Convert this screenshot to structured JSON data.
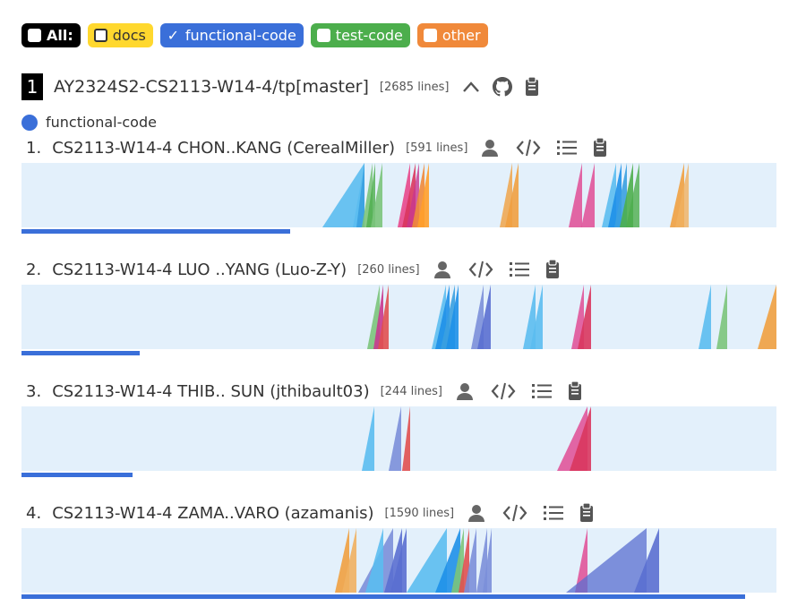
{
  "filters": {
    "all": "All:",
    "docs": "docs",
    "functional": "functional-code",
    "test": "test-code",
    "other": "other",
    "functional_check": "✓"
  },
  "repo": {
    "rank": "1",
    "name": "AY2324S2-CS2113-W14-4/tp[master]",
    "lines": "[2685 lines]"
  },
  "legend": {
    "label": "functional-code"
  },
  "colors": {
    "ramp_bg": "#e3f0fb",
    "functional": "#3a6fd9",
    "docs": "#ffd82e",
    "test": "#4cae4c",
    "other": "#f0893a"
  },
  "authors": [
    {
      "idx": "1.",
      "name": "CS2113-W14-4 CHON..KANG (CerealMiller)",
      "lines": "[591 lines]",
      "bar_fraction": 0.356,
      "spikes": [
        [
          336,
          383,
          "#5bbdf0",
          0.9
        ],
        [
          370,
          383,
          "#5bbdf0",
          0.9
        ],
        [
          374,
          383,
          "#3aa0e0",
          0.9
        ],
        [
          380,
          392,
          "#7bc47b",
          0.9
        ],
        [
          385,
          395,
          "#4cae4c",
          0.8
        ],
        [
          390,
          403,
          "#7bc47b",
          0.9
        ],
        [
          420,
          434,
          "#e8478b",
          0.9
        ],
        [
          425,
          440,
          "#d9365e",
          0.9
        ],
        [
          430,
          444,
          "#c8378f",
          0.8
        ],
        [
          436,
          450,
          "#f0893a",
          0.9
        ],
        [
          442,
          455,
          "#ff9f2a",
          0.9
        ],
        [
          534,
          548,
          "#f0a040",
          0.8
        ],
        [
          540,
          555,
          "#f0a040",
          0.9
        ],
        [
          611,
          626,
          "#e0559a",
          0.9
        ],
        [
          625,
          640,
          "#e0559a",
          0.9
        ],
        [
          648,
          664,
          "#5bbdf0",
          0.9
        ],
        [
          655,
          670,
          "#1e90e8",
          0.9
        ],
        [
          662,
          676,
          "#3aa0e0",
          0.9
        ],
        [
          668,
          683,
          "#4cae4c",
          0.9
        ],
        [
          675,
          690,
          "#4cae4c",
          0.8
        ],
        [
          724,
          740,
          "#f0a040",
          0.9
        ],
        [
          730,
          745,
          "#f0b060",
          0.8
        ]
      ]
    },
    {
      "idx": "2.",
      "name": "CS2113-W14-4 LUO ..YANG (Luo-Z-Y)",
      "lines": "[260 lines]",
      "bar_fraction": 0.157,
      "spikes": [
        [
          386,
          400,
          "#7bc47b",
          0.9
        ],
        [
          393,
          404,
          "#c8378f",
          0.9
        ],
        [
          398,
          410,
          "#e05050",
          0.9
        ],
        [
          458,
          474,
          "#5bbdf0",
          0.9
        ],
        [
          462,
          478,
          "#1e90e8",
          0.9
        ],
        [
          468,
          484,
          "#3aa0e0",
          0.9
        ],
        [
          474,
          488,
          "#1e90e8",
          0.9
        ],
        [
          502,
          516,
          "#7b8fd9",
          0.9
        ],
        [
          509,
          524,
          "#5a6fd0",
          0.9
        ],
        [
          560,
          574,
          "#5bbdf0",
          0.9
        ],
        [
          568,
          582,
          "#5bbdf0",
          0.9
        ],
        [
          614,
          628,
          "#e0559a",
          0.9
        ],
        [
          621,
          636,
          "#d9365e",
          0.9
        ],
        [
          756,
          770,
          "#5bbdf0",
          0.9
        ],
        [
          776,
          788,
          "#7bc47b",
          0.9
        ],
        [
          822,
          843,
          "#f0a040",
          0.9
        ]
      ]
    },
    {
      "idx": "3.",
      "name": "CS2113-W14-4 THIB.. SUN (jthibault03)",
      "lines": "[244 lines]",
      "bar_fraction": 0.147,
      "spikes": [
        [
          380,
          394,
          "#5bbdf0",
          0.9
        ],
        [
          410,
          424,
          "#7b8fd9",
          0.9
        ],
        [
          425,
          434,
          "#e05050",
          0.9
        ],
        [
          598,
          632,
          "#e0559a",
          0.9
        ],
        [
          612,
          636,
          "#d9365e",
          0.9
        ]
      ]
    },
    {
      "idx": "4.",
      "name": "CS2113-W14-4 ZAMA..VARO (azamanis)",
      "lines": "[1590 lines]",
      "bar_fraction": 0.958,
      "spikes": [
        [
          350,
          366,
          "#f0a040",
          0.9
        ],
        [
          358,
          374,
          "#f0b060",
          0.9
        ],
        [
          376,
          415,
          "#7b8fd9",
          0.9
        ],
        [
          384,
          404,
          "#5bbdf0",
          0.9
        ],
        [
          405,
          425,
          "#5a6fd0",
          0.9
        ],
        [
          412,
          430,
          "#5a6fd0",
          0.9
        ],
        [
          430,
          475,
          "#5bbdf0",
          0.9
        ],
        [
          462,
          490,
          "#1e90e8",
          0.9
        ],
        [
          480,
          494,
          "#7bc47b",
          0.9
        ],
        [
          488,
          500,
          "#e05050",
          0.9
        ],
        [
          494,
          508,
          "#7b8fd9",
          0.9
        ],
        [
          508,
          520,
          "#7b8fd9",
          0.9
        ],
        [
          515,
          525,
          "#7b8fd9",
          0.9
        ],
        [
          618,
          632,
          "#e0559a",
          0.9
        ],
        [
          608,
          698,
          "#5a6fd0",
          0.75
        ],
        [
          684,
          712,
          "#5a6fd0",
          0.9
        ]
      ]
    }
  ]
}
